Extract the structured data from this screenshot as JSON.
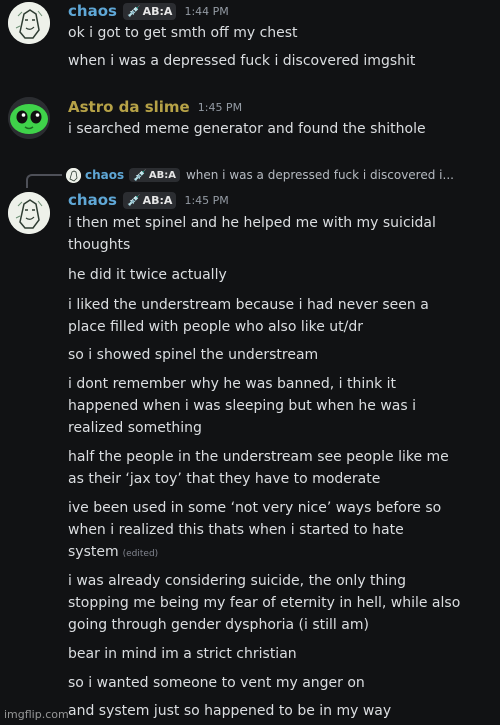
{
  "messages": [
    {
      "author": "chaos",
      "tag": "AB:A",
      "time": "1:44 PM",
      "lines": [
        "ok i got to get smth off my chest",
        "when i was a depressed fuck i discovered imgshit"
      ]
    },
    {
      "author": "Astro da slime",
      "time": "1:45 PM",
      "lines": [
        "i searched meme generator and found the shithole"
      ]
    },
    {
      "author": "chaos",
      "tag": "AB:A",
      "time": "1:45 PM",
      "reply": {
        "author": "chaos",
        "tag": "AB:A",
        "text": "when i was a depressed fuck i discovered i..."
      },
      "lines": [
        "i then met spinel and he helped me with my suicidal",
        "thoughts",
        "he did it twice actually",
        "i liked the understream because i had never seen a",
        "place filled with people who also like ut/dr",
        "so i showed spinel the understream",
        "i dont remember why he was banned, i think it",
        "happened when i was sleeping but when he was i",
        "realized something",
        "half the people in the understream see people like me",
        "as their ‘jax toy’ that they have to moderate",
        "ive been used in some ‘not very nice’ ways before so",
        "when i realized this thats when i started to hate",
        "system",
        "i was already considering suicide, the only thing",
        "stopping me being my fear of eternity in hell, while also",
        "going through gender dysphoria (i still am)",
        "bear in mind im a strict christian",
        "so i wanted someone to vent my anger on",
        "and system just so happened to be in my way"
      ],
      "edited": "(edited)"
    }
  ],
  "watermark": "imgflip.com",
  "colors": {
    "background": "#111214",
    "chaos_name": "#5fa7d6",
    "astro_name": "#b6a247",
    "message_text": "#dbdee1",
    "timestamp": "#949ba4"
  },
  "icons": {
    "tag_icon": "syringe-icon",
    "chaos_avatar": "sketch-character-avatar",
    "astro_avatar": "green-slime-alien-avatar"
  }
}
